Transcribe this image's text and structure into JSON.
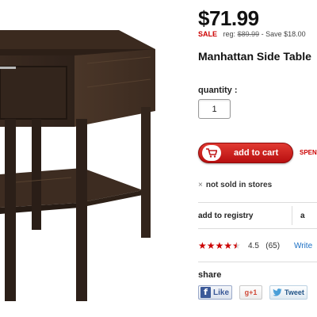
{
  "product": {
    "price": "$71.99",
    "sale_tag": "SALE",
    "reg_prefix": "reg:",
    "reg_price": "$89.99",
    "savings": "- Save $18.00",
    "title": "Manhattan Side Table"
  },
  "purchase": {
    "quantity_label": "quantity :",
    "quantity_value": "1",
    "add_to_cart_label": "add to cart",
    "spend_text": "SPEN",
    "availability": "not sold in stores",
    "availability_icon": "×"
  },
  "registry": {
    "add_to_registry_label": "add to registry",
    "truncated_link": "a"
  },
  "reviews": {
    "rating_value": 4.5,
    "rating_max": 5,
    "rating_text": "4.5",
    "review_count": "(65)",
    "write_label": "Write",
    "star_color": "#cc0000"
  },
  "share": {
    "label": "share",
    "facebook_label": "Like",
    "facebook_icon_char": "f",
    "gplus_label": "g+1",
    "tweet_label": "Tweet"
  },
  "colors": {
    "accent_red": "#cc0000",
    "link_blue": "#1a6fc4",
    "facebook_blue": "#3b5998"
  },
  "icons": [
    "furniture-product-image",
    "shopping-cart-icon",
    "close-x-icon",
    "star-icon",
    "facebook-icon",
    "twitter-bird-icon"
  ]
}
